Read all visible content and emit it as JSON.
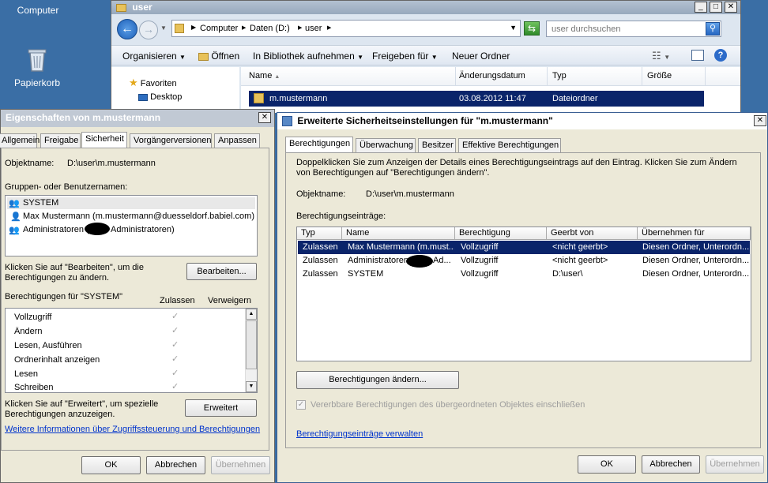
{
  "desktop": {
    "icons": [
      {
        "label": "Computer"
      },
      {
        "label": "Papierkorb"
      }
    ]
  },
  "explorer": {
    "title": "user",
    "breadcrumb": [
      "Computer",
      "Daten (D:)",
      "user"
    ],
    "search_placeholder": "user durchsuchen",
    "toolbar": {
      "organize": "Organisieren",
      "open": "Öffnen",
      "library": "In Bibliothek aufnehmen",
      "share": "Freigeben für",
      "new_folder": "Neuer Ordner"
    },
    "nav": {
      "favorites": "Favoriten",
      "desktop": "Desktop"
    },
    "columns": [
      "Name",
      "Änderungsdatum",
      "Typ",
      "Größe"
    ],
    "rows": [
      {
        "name": "m.mustermann",
        "date": "03.08.2012 11:47",
        "type": "Dateiordner"
      }
    ]
  },
  "props": {
    "title": "Eigenschaften von m.mustermann",
    "tabs": [
      "Allgemein",
      "Freigabe",
      "Sicherheit",
      "Vorgängerversionen",
      "Anpassen"
    ],
    "object_label": "Objektname:",
    "object_value": "D:\\user\\m.mustermann",
    "groups_label": "Gruppen- oder Benutzernamen:",
    "groups": [
      "SYSTEM",
      "Max Mustermann (m.mustermann@duesseldorf.babiel.com)",
      "Administratoren (",
      "Administratoren)"
    ],
    "edit_hint": "Klicken Sie auf \"Bearbeiten\", um die Berechtigungen zu ändern.",
    "edit_button": "Bearbeiten...",
    "perms_for": "Berechtigungen für \"SYSTEM\"",
    "allow_col": "Zulassen",
    "deny_col": "Verweigern",
    "perms": [
      "Vollzugriff",
      "Ändern",
      "Lesen, Ausführen",
      "Ordnerinhalt anzeigen",
      "Lesen",
      "Schreiben"
    ],
    "advanced_hint": "Klicken Sie auf \"Erweitert\", um spezielle Berechtigungen anzuzeigen.",
    "advanced_button": "Erweitert",
    "more_info": "Weitere Informationen über Zugriffssteuerung und Berechtigungen",
    "ok": "OK",
    "cancel": "Abbrechen",
    "apply": "Übernehmen"
  },
  "advanced": {
    "title": "Erweiterte Sicherheitseinstellungen für \"m.mustermann\"",
    "tabs": [
      "Berechtigungen",
      "Überwachung",
      "Besitzer",
      "Effektive Berechtigungen"
    ],
    "info": "Doppelklicken Sie zum Anzeigen der Details eines Berechtigungseintrags auf den Eintrag. Klicken Sie zum Ändern von Berechtigungen auf \"Berechtigungen ändern\".",
    "object_label": "Objektname:",
    "object_value": "D:\\user\\m.mustermann",
    "entries_label": "Berechtigungseinträge:",
    "columns": [
      "Typ",
      "Name",
      "Berechtigung",
      "Geerbt von",
      "Übernehmen für"
    ],
    "rows": [
      {
        "type": "Zulassen",
        "name": "Max Mustermann (m.must...",
        "perm": "Vollzugriff",
        "inherited": "<nicht geerbt>",
        "applies": "Diesen Ordner, Unterordn..."
      },
      {
        "type": "Zulassen",
        "name": "Administratoren (",
        "name2": "Ad...",
        "perm": "Vollzugriff",
        "inherited": "<nicht geerbt>",
        "applies": "Diesen Ordner, Unterordn..."
      },
      {
        "type": "Zulassen",
        "name": "SYSTEM",
        "perm": "Vollzugriff",
        "inherited": "D:\\user\\",
        "applies": "Diesen Ordner, Unterordn..."
      }
    ],
    "change_button": "Berechtigungen ändern...",
    "inherit_check": "Vererbbare Berechtigungen des übergeordneten Objektes einschließen",
    "manage_link": "Berechtigungseinträge verwalten",
    "ok": "OK",
    "cancel": "Abbrechen",
    "apply": "Übernehmen"
  }
}
